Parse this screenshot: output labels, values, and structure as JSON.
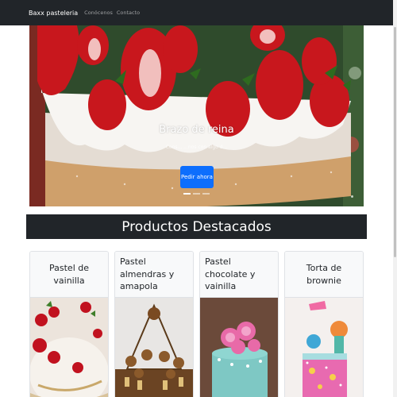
{
  "navbar": {
    "brand": "Baxx pasteleria",
    "links": [
      "Conócenos",
      "Contacto"
    ]
  },
  "carousel": {
    "title": "Brazo de reina",
    "text": "Cons... ...nos con algo d...",
    "button": "Pedir ahora",
    "indicators": 3,
    "active_index": 0
  },
  "section": {
    "title": "Productos Destacados"
  },
  "products": [
    {
      "name": "Pastel de vainilla"
    },
    {
      "name": "Pastel almendras y amapola"
    },
    {
      "name": "Pastel chocolate y vainilla"
    },
    {
      "name": "Torta de brownie"
    }
  ],
  "colors": {
    "navbar": "#212529",
    "primary_button": "#0d6efd",
    "card_bg": "#f8f9fa"
  }
}
